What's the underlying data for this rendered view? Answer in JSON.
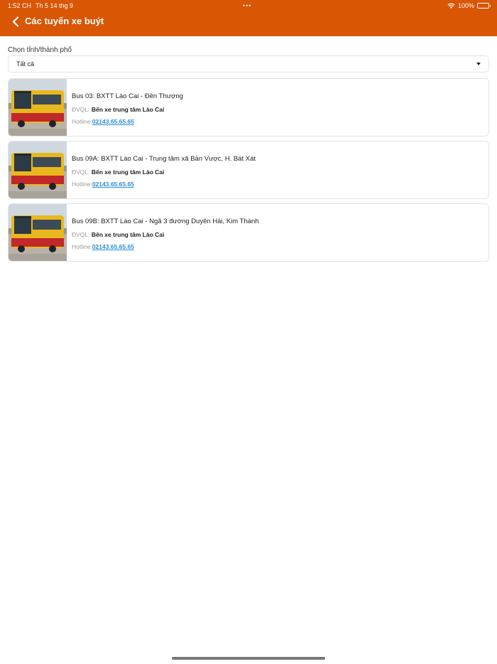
{
  "status_bar": {
    "time": "1:52 CH",
    "date": "Th 5 14 thg 9",
    "dots": "•••",
    "battery_text": "100%"
  },
  "header": {
    "title": "Các tuyến xe buýt",
    "back_icon": "chevron-left-icon",
    "background": "#d95605"
  },
  "filter": {
    "label": "Chọn tỉnh/thành phố",
    "selected": "Tất cả"
  },
  "routes": [
    {
      "title": "Bus 03: BXTT Lào Cai - Đền Thượng",
      "operator_label": "ĐVQL:",
      "operator": "Bến xe trung tâm Lào Cai",
      "hotline_label": "Hotline:",
      "hotline": "02143.65.65.65"
    },
    {
      "title": "Bus 09A: BXTT Lào Cai - Trung tâm xã Bản Vược, H. Bát Xát",
      "operator_label": "ĐVQL:",
      "operator": "Bến xe trung tâm Lào Cai",
      "hotline_label": "Hotline:",
      "hotline": "02143.65.65.65"
    },
    {
      "title": "Bus 09B: BXTT Lào Cai - Ngã 3 đường Duyên Hải, Kim Thành",
      "operator_label": "ĐVQL:",
      "operator": "Bến xe trung tâm Lào Cai",
      "hotline_label": "Hotline:",
      "hotline": "02143.65.65.65"
    }
  ],
  "colors": {
    "accent": "#d95605",
    "link": "#2a8fd6"
  }
}
